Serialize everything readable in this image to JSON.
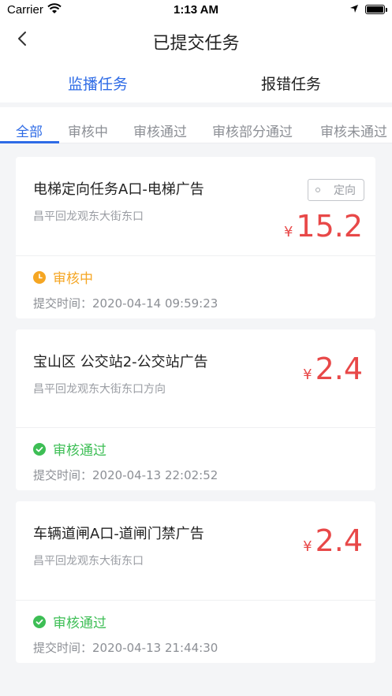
{
  "status_bar": {
    "carrier": "Carrier",
    "time": "1:13 AM"
  },
  "nav": {
    "title": "已提交任务"
  },
  "segments": [
    "监播任务",
    "报错任务"
  ],
  "filters": [
    "全部",
    "审核中",
    "审核通过",
    "审核部分通过",
    "审核未通过"
  ],
  "colors": {
    "accent": "#2E6BE6",
    "price": "#E84848",
    "pending": "#F5A623",
    "approved": "#3DBE55"
  },
  "tasks": [
    {
      "name": "电梯定向任务A口-电梯广告",
      "address": "昌平回龙观东大街东口",
      "currency": "¥",
      "price": "15.2",
      "tag": "定向",
      "status": "审核中",
      "status_icon": "clock-icon",
      "submit_time": "提交时间：2020-04-14 09:59:23"
    },
    {
      "name": "宝山区 公交站2-公交站广告",
      "address": "昌平回龙观东大街东口方向",
      "currency": "¥",
      "price": "2.4",
      "status": "审核通过",
      "status_icon": "check-circle-icon",
      "submit_time": "提交时间：2020-04-13 22:02:52"
    },
    {
      "name": "车辆道闸A口-道闸门禁广告",
      "address": "昌平回龙观东大街东口",
      "currency": "¥",
      "price": "2.4",
      "status": "审核通过",
      "status_icon": "check-circle-icon",
      "submit_time": "提交时间：2020-04-13 21:44:30"
    }
  ]
}
